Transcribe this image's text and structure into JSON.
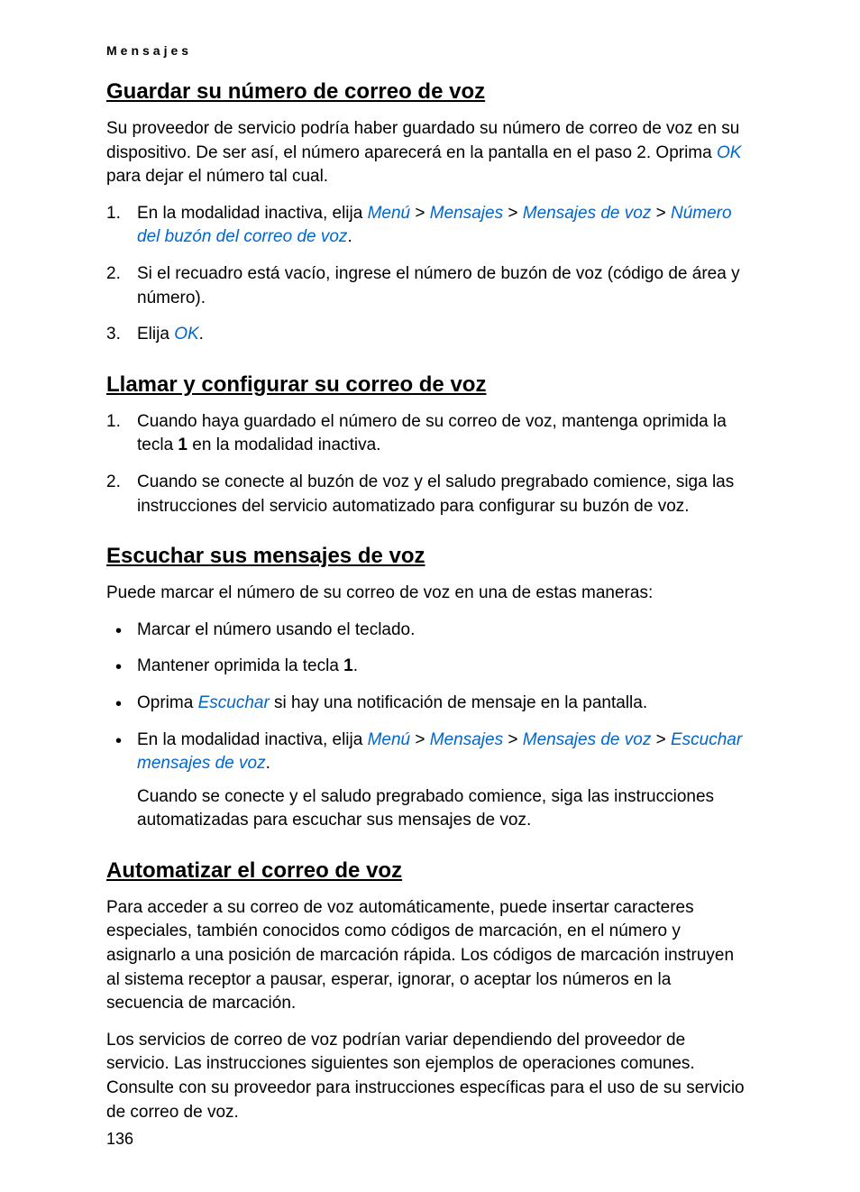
{
  "header": "Mensajes",
  "section1": {
    "title": "Guardar su número de correo de voz",
    "intro_a": "Su proveedor de servicio podría haber guardado su número de correo de voz en su dispositivo. De ser así, el número aparecerá en la pantalla en el paso 2. Oprima ",
    "intro_link": "OK",
    "intro_b": " para dejar el número tal cual.",
    "li1_a": "En la modalidad inactiva, elija ",
    "li1_menu": "Menú",
    "li1_sep1": " > ",
    "li1_mensajes": "Mensajes",
    "li1_sep2": " > ",
    "li1_mensajes_voz": "Mensajes de voz",
    "li1_sep3": " > ",
    "li1_numero": "Número del buzón del correo de voz",
    "li1_end": ".",
    "li2": "Si el recuadro está vacío, ingrese el número de buzón de voz (código de área y número).",
    "li3_a": "Elija ",
    "li3_link": "OK",
    "li3_end": "."
  },
  "section2": {
    "title": "Llamar y configurar su correo de voz",
    "li1_a": "Cuando haya guardado el número de su correo de voz, mantenga oprimida la tecla ",
    "li1_key": "1",
    "li1_b": " en la modalidad inactiva.",
    "li2": "Cuando se conecte al buzón de voz y el saludo pregrabado comience, siga las instrucciones del servicio automatizado para configurar su buzón de voz."
  },
  "section3": {
    "title": "Escuchar sus mensajes de voz",
    "intro": "Puede marcar el número de su correo de voz en una de estas maneras:",
    "li1": "Marcar el número usando el teclado.",
    "li2_a": "Mantener oprimida la tecla ",
    "li2_key": "1",
    "li2_end": ".",
    "li3_a": "Oprima ",
    "li3_link": "Escuchar",
    "li3_b": " si hay una notificación de mensaje en la pantalla.",
    "li4_a": "En la modalidad inactiva, elija ",
    "li4_menu": "Menú",
    "li4_sep1": " > ",
    "li4_mensajes": "Mensajes",
    "li4_sep2": " > ",
    "li4_mensajes_voz": "Mensajes de voz",
    "li4_sep3": " > ",
    "li4_escuchar": "Escuchar mensajes de voz",
    "li4_end": ".",
    "li4_sub": "Cuando se conecte y el saludo pregrabado comience, siga las instrucciones automatizadas para escuchar sus mensajes de voz."
  },
  "section4": {
    "title": "Automatizar el correo de voz",
    "p1": "Para acceder a su correo de voz automáticamente, puede insertar caracteres especiales, también conocidos como códigos de marcación, en el número y asignarlo a una posición de marcación rápida. Los códigos de marcación instruyen al sistema receptor a pausar, esperar, ignorar, o aceptar los números en la secuencia de marcación.",
    "p2": "Los servicios de correo de voz podrían variar dependiendo del proveedor de servicio. Las instrucciones siguientes son ejemplos de operaciones comunes. Consulte con su proveedor para instrucciones específicas para el uso de su servicio de correo de voz."
  },
  "page_number": "136"
}
